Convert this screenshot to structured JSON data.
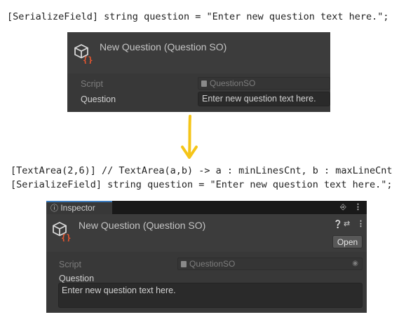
{
  "top_code": "[SerializeField] string question = \"Enter new question text here.\";",
  "bottom_code": {
    "line1": "[TextArea(2,6)] // TextArea(a,b) -> a : minLinesCnt, b : maxLineCnt",
    "line2": "[SerializeField] string question = \"Enter new question text here.\";"
  },
  "panel_top": {
    "title": "New Question (Question SO)",
    "script_label": "Script",
    "script_value": "QuestionSO",
    "question_label": "Question",
    "question_value": "Enter new question text here."
  },
  "panel_bottom": {
    "tab_label": "Inspector",
    "tab_icon": "info-icon",
    "title": "New Question (Question SO)",
    "open_label": "Open",
    "script_label": "Script",
    "script_value": "QuestionSO",
    "question_label": "Question",
    "question_value": "Enter new question text here."
  },
  "colors": {
    "arrow": "#f5c518",
    "panel_bg": "#383838",
    "field_bg": "#2a2a2a",
    "icon_bracket": "#e8562f",
    "tab_accent": "#3a79bb"
  }
}
